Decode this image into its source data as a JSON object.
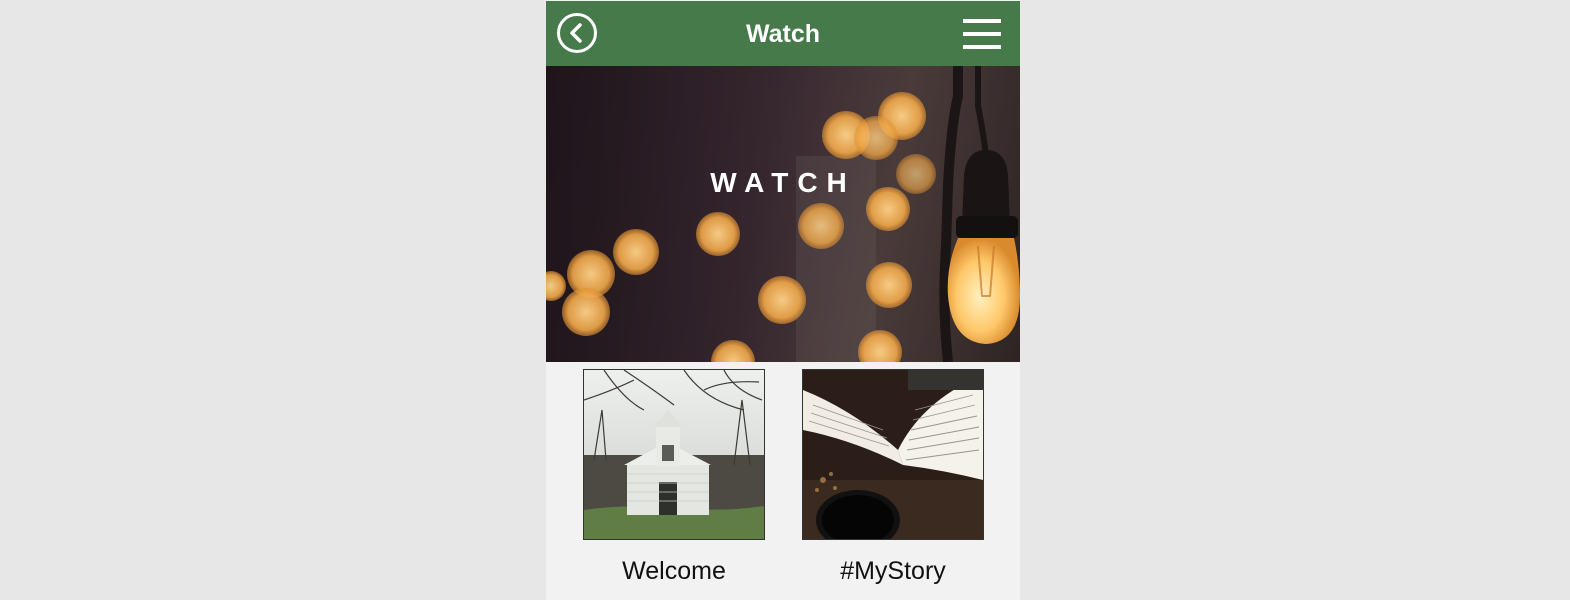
{
  "header": {
    "title": "Watch",
    "back_icon": "chevron-left-circle-icon",
    "menu_icon": "hamburger-menu-icon",
    "color": "#467a4a"
  },
  "hero": {
    "title": "WATCH"
  },
  "tiles": [
    {
      "label": "Welcome",
      "image": "white-chapel-photo"
    },
    {
      "label": "#MyStory",
      "image": "open-book-coffee-photo"
    }
  ]
}
